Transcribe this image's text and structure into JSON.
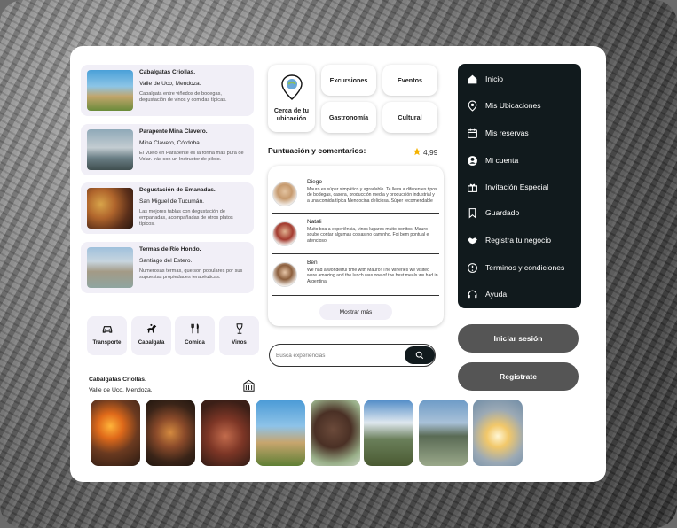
{
  "experiences": [
    {
      "title": "Cabalgatas Criollas.",
      "location": "Valle de Uco, Mendoza.",
      "description": "Cabalgata entre viñedos de bodegas, degustación de vinos y comidas típicas."
    },
    {
      "title": "Parapente Mina Clavero.",
      "location": "Mina Clavero, Córdoba.",
      "description": "El Vuelo en Parapente es la forma más pura de Volar. Irás con un Instructor de piloto."
    },
    {
      "title": "Degustación de Emanadas.",
      "location": "San Miguel de Tucumán.",
      "description": "Las mejores tablas con degustación de empanadas, acompañadas de otros platos típicos."
    },
    {
      "title": "Termas de Río Hondo.",
      "location": "Santiago del Estero.",
      "description": "Numerosas termas, que son populares por sus supuestas propiedades terapéuticas."
    }
  ],
  "categories": [
    {
      "label": "Transporte",
      "icon": "car-icon"
    },
    {
      "label": "Cabalgata",
      "icon": "horse-icon"
    },
    {
      "label": "Comida",
      "icon": "cutlery-icon"
    },
    {
      "label": "Vinos",
      "icon": "wine-glass-icon"
    }
  ],
  "tiles": {
    "nearby": "Cerca de tu ubicación",
    "excursiones": "Excursiones",
    "eventos": "Eventos",
    "gastronomia": "Gastronomía",
    "cultural": "Cultural"
  },
  "reviews_section": {
    "title": "Puntuación y comentarios:",
    "rating": "4,99",
    "show_more": "Mostrar más"
  },
  "reviews": [
    {
      "name": "Diego",
      "text": "Mauro es súper simpático y agradable. Te lleva a diferentes tipos de bodegas, casera, producción media y producción industrial y a una comida típica Mendocina deliciosa. Súper recomendable"
    },
    {
      "name": "Natali",
      "text": "Muito boa a experiência, vinos lugares muito bonitos. Mauro soube contar algumas coisas no caminho. Foi bem pontual e atencioso."
    },
    {
      "name": "Ben",
      "text": "We had a wonderful time with Mauro! The wineries we visited were amazing and the lunch was one of the best meals we had in Argentina."
    }
  ],
  "search": {
    "placeholder": "Busca experiencias"
  },
  "selected": {
    "title": "Cabalgatas Criollas.",
    "location": "Valle de Uco, Mendoza."
  },
  "menu": [
    {
      "label": "Inicio",
      "icon": "home-icon"
    },
    {
      "label": "Mis Ubicaciones",
      "icon": "location-pin-icon"
    },
    {
      "label": "Mis reservas",
      "icon": "calendar-icon"
    },
    {
      "label": "Mi cuenta",
      "icon": "user-icon"
    },
    {
      "label": "Invitación Especial",
      "icon": "gift-icon"
    },
    {
      "label": "Guardado",
      "icon": "bookmark-icon"
    },
    {
      "label": "Registra tu negocio",
      "icon": "handshake-icon"
    },
    {
      "label": "Terminos y condiciones",
      "icon": "info-icon"
    },
    {
      "label": "Ayuda",
      "icon": "headset-icon"
    }
  ],
  "auth": {
    "login": "Iniciar sesión",
    "register": "Registrate"
  },
  "colors": {
    "sidebar": "#111a1d",
    "button": "#555555",
    "card_bg": "#f1eff7",
    "star": "#f5b301"
  }
}
